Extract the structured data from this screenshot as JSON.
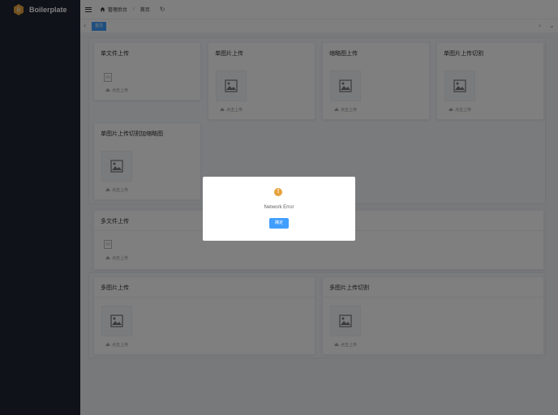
{
  "app": {
    "brand": "Boilerplate"
  },
  "header": {
    "breadcrumb_home": "管理后台",
    "breadcrumb_current": "首页"
  },
  "tabs": {
    "active_label": "首页"
  },
  "cards": {
    "single_file": {
      "title": "单文件上传",
      "tip": "点击上传"
    },
    "single_image": {
      "title": "单图片上传",
      "tip": "点击上传"
    },
    "thumbnail": {
      "title": "缩略图上传",
      "tip": "点击上传"
    },
    "single_image_crop": {
      "title": "单图片上传切割",
      "tip": "点击上传"
    },
    "single_image_crop_thumb": {
      "title": "单图片上传切割加缩略图",
      "tip": "点击上传"
    },
    "multi_file": {
      "title": "多文件上传",
      "tip": "点击上传"
    },
    "multi_image": {
      "title": "多图片上传",
      "tip": "点击上传"
    },
    "multi_image_crop": {
      "title": "多图片上传切割",
      "tip": "点击上传"
    }
  },
  "dialog": {
    "message": "Network Error",
    "confirm_label": "确定"
  },
  "colors": {
    "sidebar": "#1f2433",
    "primary": "#409eff",
    "warning": "#e6a23c"
  },
  "icons": [
    "brand-logo",
    "menu-icon",
    "home-icon",
    "refresh-icon",
    "chevron-left-icon",
    "chevron-right-icon",
    "chevron-down-icon",
    "image-icon",
    "file-icon",
    "cloud-upload-icon",
    "warning-icon"
  ]
}
